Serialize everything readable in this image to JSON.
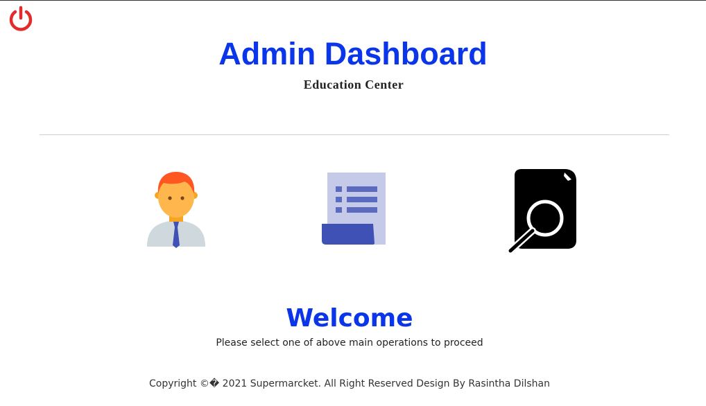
{
  "header": {
    "title": "Admin Dashboard",
    "subtitle": "Education Center"
  },
  "toolbar": {
    "power_icon": "power-icon",
    "power_color": "#e32b2b"
  },
  "operations": [
    {
      "icon": "user-icon"
    },
    {
      "icon": "report-document-icon"
    },
    {
      "icon": "search-document-icon"
    }
  ],
  "welcome": {
    "heading": "Welcome",
    "message": "Please select one of above main operations to proceed"
  },
  "footer": {
    "copyright": "Copyright ©� 2021 Supermarcket. All Right Reserved Design By Rasintha Dilshan"
  },
  "colors": {
    "accent": "#0a35e8",
    "power": "#e32b2b"
  }
}
